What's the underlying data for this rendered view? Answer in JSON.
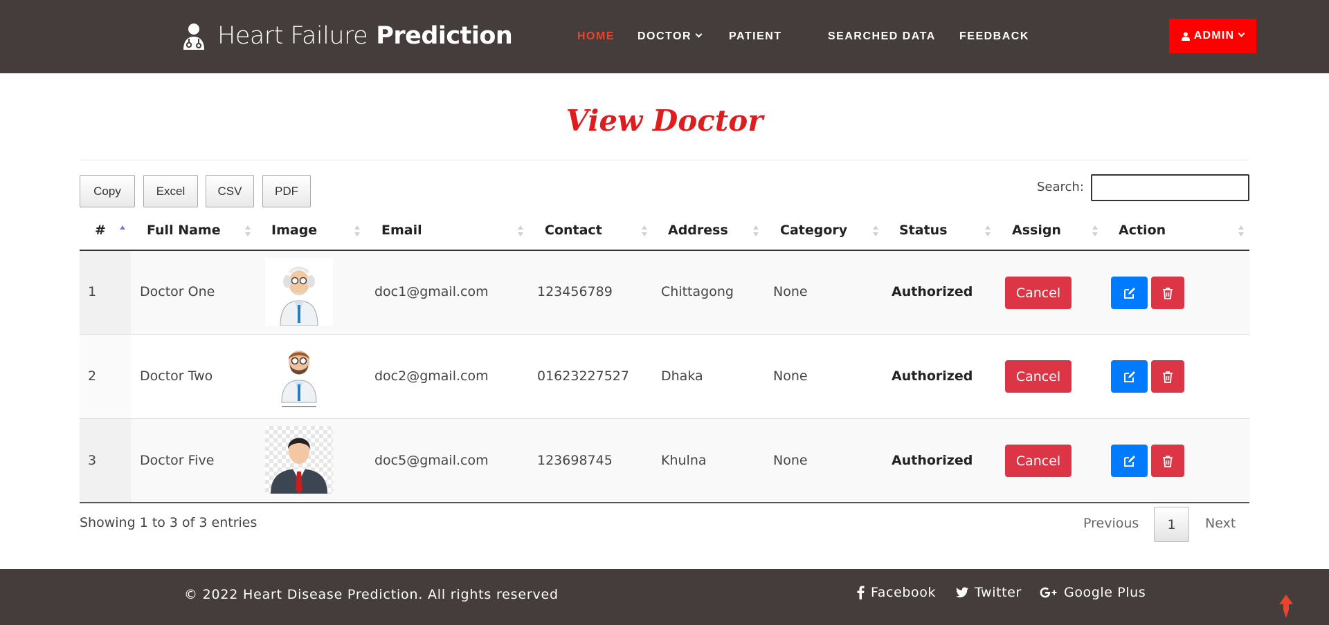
{
  "header": {
    "brand_light": "Heart Failure",
    "brand_bold": "Prediction",
    "nav": {
      "home": "HOME",
      "doctor": "DOCTOR",
      "patient": "PATIENT",
      "searched": "SEARCHED DATA",
      "feedback": "FEEDBACK"
    },
    "admin": "ADMIN"
  },
  "page": {
    "title": "View Doctor"
  },
  "toolbar": {
    "copy": "Copy",
    "excel": "Excel",
    "csv": "CSV",
    "pdf": "PDF",
    "search_label": "Search:",
    "search_value": ""
  },
  "table": {
    "columns": [
      "#",
      "Full Name",
      "Image",
      "Email",
      "Contact",
      "Address",
      "Category",
      "Status",
      "Assign",
      "Action"
    ],
    "rows": [
      {
        "id": "1",
        "name": "Doctor One",
        "image": "doctor-avatar-elderly",
        "email": "doc1@gmail.com",
        "contact": "123456789",
        "address": "Chittagong",
        "category": "None",
        "status": "Authorized",
        "assign": "Cancel"
      },
      {
        "id": "2",
        "name": "Doctor Two",
        "image": "doctor-avatar-bearded",
        "email": "doc2@gmail.com",
        "contact": "01623227527",
        "address": "Dhaka",
        "category": "None",
        "status": "Authorized",
        "assign": "Cancel"
      },
      {
        "id": "3",
        "name": "Doctor Five",
        "image": "businessman-avatar",
        "email": "doc5@gmail.com",
        "contact": "123698745",
        "address": "Khulna",
        "category": "None",
        "status": "Authorized",
        "assign": "Cancel"
      }
    ]
  },
  "pagination": {
    "info": "Showing 1 to 3 of 3 entries",
    "previous": "Previous",
    "current": "1",
    "next": "Next"
  },
  "footer": {
    "copyright": "© 2022 Heart Disease Prediction. All rights reserved",
    "facebook": "Facebook",
    "twitter": "Twitter",
    "google": "Google Plus"
  },
  "colors": {
    "header_bg": "#443d3b",
    "accent_red": "#fe0000",
    "nav_active": "#e8452c",
    "title_red": "#dc1e1e",
    "danger": "#dc3545",
    "primary": "#007bff"
  },
  "icons": [
    "doctor-logo-icon",
    "user-icon",
    "chevron-down-icon",
    "sort-icon",
    "edit-icon",
    "trash-icon",
    "facebook-icon",
    "twitter-icon",
    "google-plus-icon",
    "scroll-top-arrow-icon"
  ]
}
